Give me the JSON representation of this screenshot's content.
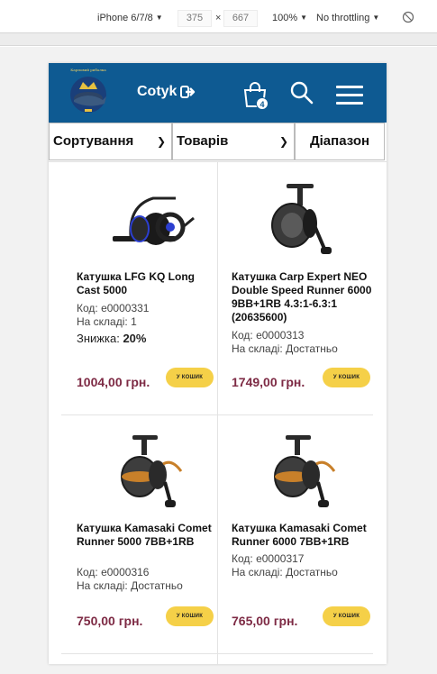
{
  "devtools": {
    "device": "iPhone 6/7/8",
    "width": "375",
    "height": "667",
    "times": "×",
    "zoom": "100%",
    "throttling": "No throttling"
  },
  "header": {
    "logo_text": "Карповий рибалка",
    "cart_label": "Cotyk",
    "bag_count": "4",
    "colors": {
      "header_bg": "#0e5a92",
      "price": "#7d2a44",
      "buy_button": "#f5d048"
    }
  },
  "filters": {
    "sort_label": "Сортування",
    "count_label": "Товарів",
    "range_label": "Діапазон"
  },
  "products": [
    {
      "name": "Катушка LFG KQ Long Cast 5000",
      "code": "Код: e0000331",
      "stock": "На складі: 1",
      "discount_label": "Знижка:",
      "discount_value": "20%",
      "price": "1004,00 грн.",
      "buy": "У КОШИК"
    },
    {
      "name": "Катушка Carp Expert NEO Double Speed Runner 6000 9BB+1RB 4.3:1-6.3:1 (20635600)",
      "code": "Код: e0000313",
      "stock": "На складі: Достатньо",
      "price": "1749,00 грн.",
      "buy": "У КОШИК"
    },
    {
      "name": "Катушка Kamasaki Comet Runner 5000 7BB+1RB",
      "code": "Код: e0000316",
      "stock": "На складі: Достатньо",
      "price": "750,00 грн.",
      "buy": "У КОШИК"
    },
    {
      "name": "Катушка Kamasaki Comet Runner 6000 7BB+1RB",
      "code": "Код: e0000317",
      "stock": "На складі: Достатньо",
      "price": "765,00 грн.",
      "buy": "У КОШИК"
    }
  ]
}
